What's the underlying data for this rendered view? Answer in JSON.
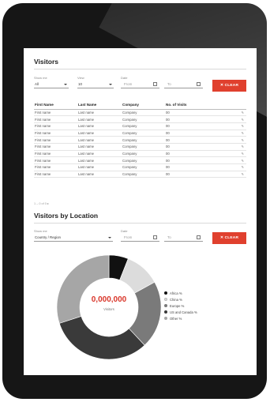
{
  "visitors": {
    "title": "Visitors",
    "filters": {
      "show_me_label": "Show me",
      "show_me_value": "All",
      "view_label": "View",
      "view_value": "10",
      "date_label": "Date",
      "from_placeholder": "From",
      "to_placeholder": "To",
      "clear_label": "✕ CLEAR"
    },
    "columns": [
      "First Name",
      "Last Name",
      "Company",
      "No. of Visits"
    ],
    "rows": [
      [
        "First name",
        "Last name",
        "Company",
        "00"
      ],
      [
        "First name",
        "Last name",
        "Company",
        "00"
      ],
      [
        "First name",
        "Last name",
        "Company",
        "00"
      ],
      [
        "First name",
        "Last name",
        "Company",
        "00"
      ],
      [
        "First name",
        "Last name",
        "Company",
        "00"
      ],
      [
        "First name",
        "Last name",
        "Company",
        "00"
      ],
      [
        "First name",
        "Last name",
        "Company",
        "00"
      ],
      [
        "First name",
        "Last name",
        "Company",
        "00"
      ],
      [
        "First name",
        "Last name",
        "Company",
        "00"
      ],
      [
        "First name",
        "Last name",
        "Company",
        "00"
      ]
    ],
    "row_action_icon": "edit-icon",
    "pager_text": "1 – 0 of 0 ▸"
  },
  "location": {
    "title": "Visitors by Location",
    "filters": {
      "show_me_label": "Show me",
      "show_me_value": "Country / Region",
      "date_label": "Date",
      "from_placeholder": "From",
      "to_placeholder": "To",
      "clear_label": "✕ CLEAR"
    },
    "total_value": "0,000,000",
    "total_label": "Visitors",
    "segments": [
      {
        "name": "Africa %",
        "value": 6,
        "color": "#111111"
      },
      {
        "name": "China %",
        "value": 11,
        "color": "#dcdcdc"
      },
      {
        "name": "Europe %",
        "value": 21,
        "color": "#7a7a7a"
      },
      {
        "name": "US and Canada %",
        "value": 32,
        "color": "#3a3a3a"
      },
      {
        "name": "Other %",
        "value": 30,
        "color": "#a6a6a6"
      }
    ]
  },
  "colors": {
    "accent": "#e0402e",
    "device": "#161616"
  }
}
